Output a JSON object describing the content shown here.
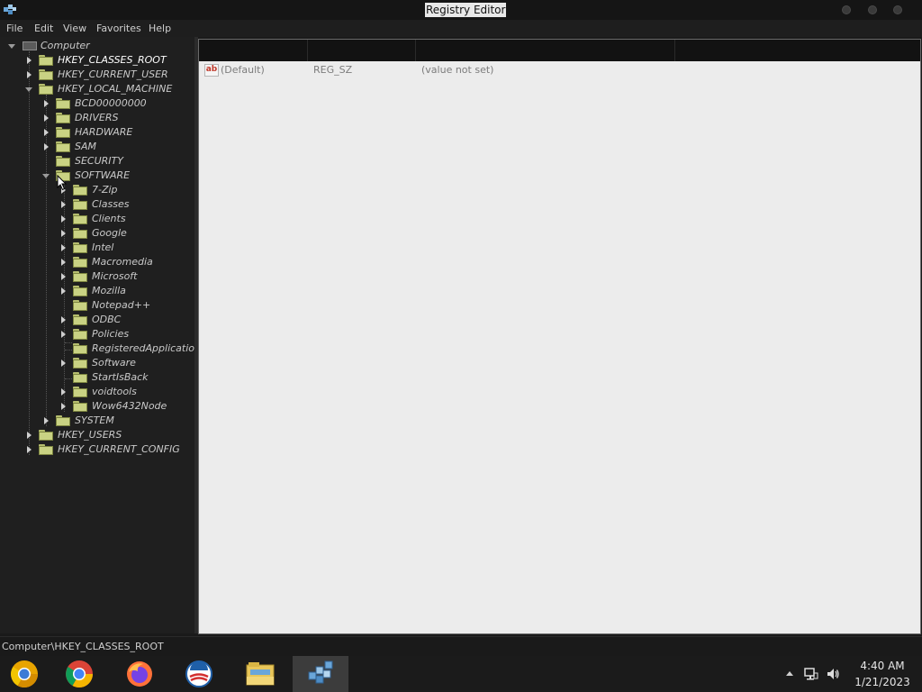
{
  "window": {
    "title": "Registry Editor",
    "title_bg": "#e8e8e8"
  },
  "menu": [
    "File",
    "Edit",
    "View",
    "Favorites",
    "Help"
  ],
  "tree": {
    "root": "Computer",
    "hives": {
      "classes_root": "HKEY_CLASSES_ROOT",
      "current_user": "HKEY_CURRENT_USER",
      "local_machine": "HKEY_LOCAL_MACHINE",
      "users": "HKEY_USERS",
      "current_config": "HKEY_CURRENT_CONFIG"
    },
    "hklm_children": [
      "BCD00000000",
      "DRIVERS",
      "HARDWARE",
      "SAM",
      "SECURITY",
      "SOFTWARE",
      "SYSTEM"
    ],
    "software_children": [
      "7-Zip",
      "Classes",
      "Clients",
      "Google",
      "Intel",
      "Macromedia",
      "Microsoft",
      "Mozilla",
      "Notepad++",
      "ODBC",
      "Policies",
      "RegisteredApplications",
      "Software",
      "StartIsBack",
      "voidtools",
      "Wow6432Node"
    ],
    "folder_color": "#c9d283"
  },
  "values_list": {
    "rows": [
      {
        "name": "(Default)",
        "type": "REG_SZ",
        "data": "(value not set)"
      }
    ]
  },
  "status": {
    "path": "Computer\\HKEY_CLASSES_ROOT"
  },
  "taskbar": {
    "apps": [
      "chrome-canary-icon",
      "chrome-icon",
      "firefox-icon",
      "obama-logo-icon",
      "file-explorer-icon",
      "registry-editor-icon"
    ],
    "time": "4:40 AM",
    "date": "1/21/2023"
  }
}
